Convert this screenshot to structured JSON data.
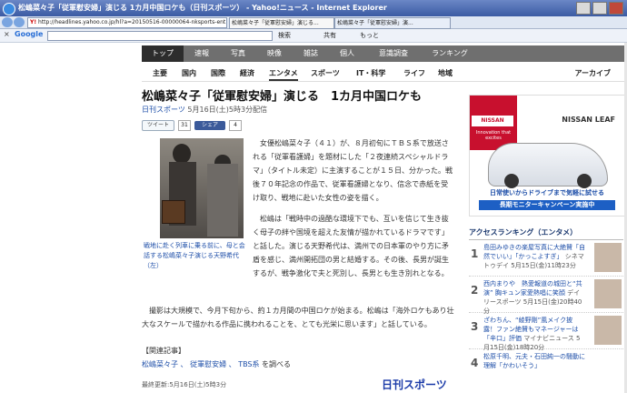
{
  "window": {
    "title": "松嶋菜々子「従軍慰安婦」演じる 1カ月中国ロケも（日刊スポーツ） - Yahoo!ニュース - Internet Explorer"
  },
  "address": {
    "url": "http://headlines.yahoo.co.jp/hl?a=20150516-00000064-nksports-ent"
  },
  "tabs": [
    {
      "label": "松嶋菜々子「従軍慰安婦」演じる..."
    },
    {
      "label": "松嶋菜々子「従軍慰安婦」演..."
    }
  ],
  "google_bar": {
    "logo": "Google",
    "search_label": "検索",
    "share_label": "共有",
    "more_label": "もっと"
  },
  "main_nav": [
    "トップ",
    "速報",
    "写真",
    "映像",
    "雑誌",
    "個人",
    "意識調査",
    "ランキング"
  ],
  "sub_nav": [
    "主要",
    "国内",
    "国際",
    "経済",
    "エンタメ",
    "スポーツ",
    "IT・科学",
    "ライフ",
    "地域"
  ],
  "archive_label": "アーカイブ",
  "article": {
    "title": "松嶋菜々子「従軍慰安婦」演じる　1カ月中国ロケも",
    "source": "日刊スポーツ",
    "date": "5月16日(土)5時3分配信",
    "tweet_label": "ツイート",
    "tweet_count": "31",
    "share_label": "シェア",
    "share_count": "4",
    "caption": "戦地に赴く列車に乗る前に、母と会話する松嶋菜々子演じる天野希代（左）",
    "p1": "女優松嶋菜々子（４１）が、８月初旬にＴＢＳ系で放送される「従軍看護婦」を題材にした「２夜連続スペシャルドラマ」（タイトル未定）に主演することが１５日、分かった。戦後７０年記念の作品で、従軍看護婦となり、信念で赤紙を受け取り、戦地に赴いた女性の姿を描く。",
    "p2": "松嶋は「戦時中の過酷な環境下でも、互いを信じて生き抜く母子の絆や国境を超えた友情が描かれているドラマです」と話した。演じる天野希代は、満州での日本軍のやり方に矛盾を感じ、満州開拓団の男と結婚する。その後、長男が誕生するが、戦争激化で夫と死別し、長男とも生き別れとなる。",
    "p3": "撮影は大規模で、今月下旬から、約１カ月間の中国ロケが始まる。松嶋は「海外ロケもあり壮大なスケールで描かれる作品に携われることを、とても光栄に思います」と話している。",
    "related_heading": "【関連記事】",
    "related_links": [
      "松嶋菜々子",
      "従軍慰安婦",
      "TBS系"
    ],
    "related_suffix": "を調べる",
    "updated": "最終更新:5月16日(土)5時3分",
    "publisher_logo": "日刊スポーツ"
  },
  "ad": {
    "brand": "NISSAN",
    "tagline": "Innovation that excites",
    "model": "NISSAN LEAF",
    "line1": "日常使いからドライブまで気軽に試せる",
    "line2": "長期モニターキャンペーン実施中"
  },
  "ranking": {
    "heading": "アクセスランキング（エンタメ）",
    "items": [
      {
        "no": "1",
        "text": "島田みゆきの楽屋写真に大絶賛「自然でいい」「かっこよすぎ」",
        "source": "シネマトゥデイ",
        "time": "5月15日(金)11時23分"
      },
      {
        "no": "2",
        "text": "西内まりや　熱愛報道の城田と“共演” 胸キュン家愛熱唱に笑顔",
        "source": "デイリースポーツ",
        "time": "5月15日(金)20時40分"
      },
      {
        "no": "3",
        "text": "ざわちん、“綾野剛”風メイク披露！ファン絶賛もマネージャーは「辛口」評価",
        "source": "マイナビニュース",
        "time": "5月15日(金)18時20分"
      },
      {
        "no": "4",
        "text": "松原千明、元夫・石田純一の騒動に理解「かわいそう」",
        "source": "",
        "time": ""
      }
    ]
  }
}
